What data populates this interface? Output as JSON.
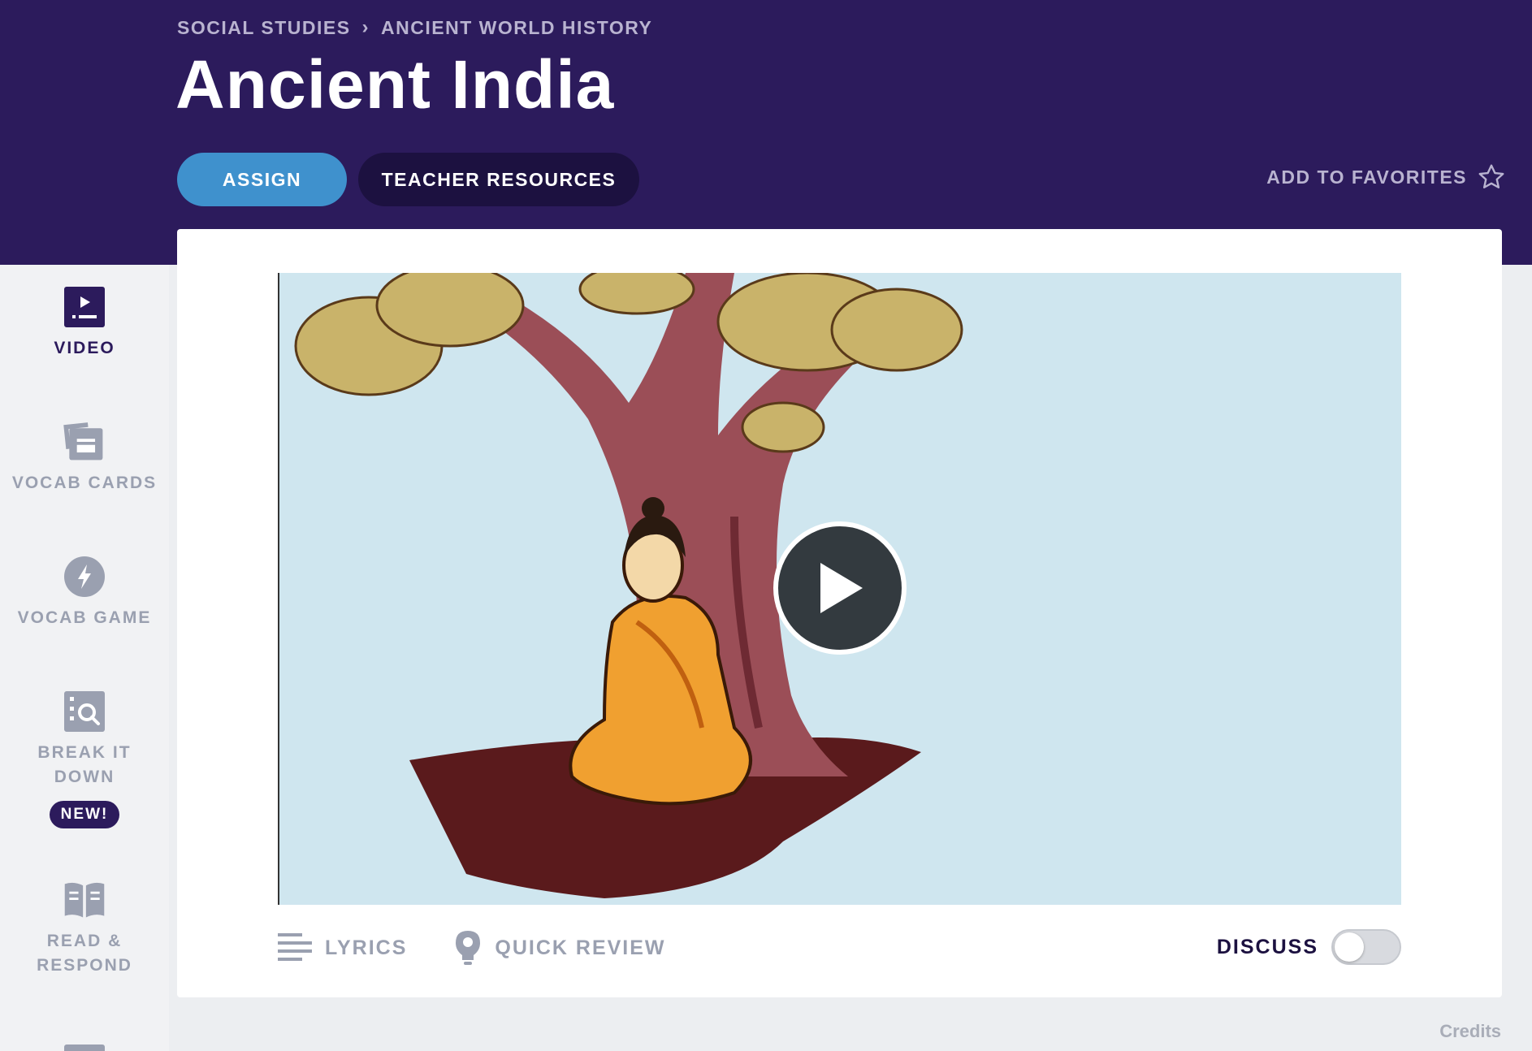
{
  "breadcrumb": {
    "items": [
      "SOCIAL STUDIES",
      "ANCIENT WORLD HISTORY"
    ],
    "separator": "›"
  },
  "page_title": "Ancient India",
  "actions": {
    "assign_label": "ASSIGN",
    "teacher_resources_label": "TEACHER RESOURCES",
    "favorites_label": "ADD TO FAVORITES",
    "favorites_icon": "star-outline-icon"
  },
  "sidebar": {
    "items": [
      {
        "label": "VIDEO",
        "icon": "video-play-icon",
        "active": true
      },
      {
        "label": "VOCAB CARDS",
        "icon": "vocab-cards-icon",
        "active": false
      },
      {
        "label": "VOCAB GAME",
        "icon": "lightning-icon",
        "active": false
      },
      {
        "label": "BREAK IT DOWN",
        "icon": "magnifier-icon",
        "active": false,
        "badge": "NEW!"
      },
      {
        "label": "READ & RESPOND",
        "icon": "open-book-icon",
        "active": false
      }
    ]
  },
  "video": {
    "play_icon": "play-icon"
  },
  "tools": {
    "lyrics_label": "LYRICS",
    "quick_review_label": "QUICK REVIEW",
    "discuss_label": "DISCUSS",
    "discuss_on": false
  },
  "footer": {
    "credits_label": "Credits"
  },
  "colors": {
    "header_bg": "#2c1b5c",
    "assign_blue": "#3f91cd",
    "teacher_btn": "#1c1140",
    "muted_text": "#9aa0b0"
  }
}
